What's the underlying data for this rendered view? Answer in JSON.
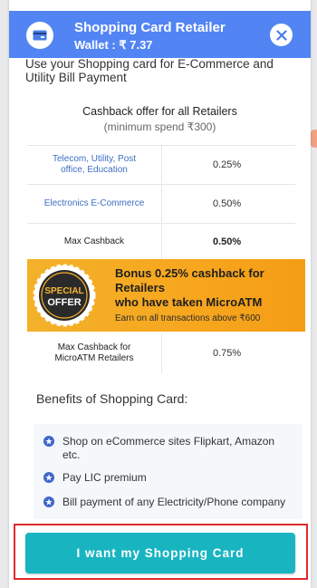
{
  "header": {
    "title": "Shopping Card Retailer",
    "wallet": "Wallet : ₹ 7.37",
    "icon": "card-icon",
    "close_icon": "close-icon",
    "color": "#5285f3"
  },
  "intro": {
    "line1": "Use your Shopping card for E-Commerce and",
    "line2": "Utility Bill Payment"
  },
  "offer": {
    "title": "Cashback offer for all Retailers",
    "subtitle": "(minimum spend ₹300)"
  },
  "table": {
    "rows": [
      {
        "label_line1": "Telecom, Utility, Post",
        "label_line2": "office, Education",
        "value": "0.25%"
      },
      {
        "label_line1": "Electronics E-Commerce",
        "label_line2": "",
        "value": "0.50%"
      },
      {
        "label_line1": "Max Cashback",
        "label_line2": "",
        "value": "0.50%"
      }
    ]
  },
  "banner": {
    "badge_line1": "SPECIAL",
    "badge_line2": "OFFER",
    "line1": "Bonus 0.25% cashback for",
    "line2": "Retailers",
    "line3": "who have taken MicroATM",
    "line4": "Earn on all transactions above ₹600"
  },
  "microatm": {
    "label_line1": "Max Cashback for",
    "label_line2": "MicroATM Retailers",
    "value": "0.75%"
  },
  "benefits": {
    "title": "Benefits of Shopping Card:",
    "items": [
      {
        "line1": "Shop on eCommerce sites Flipkart, Amazon",
        "line2": "etc."
      },
      {
        "line1": "Pay LIC premium",
        "line2": ""
      },
      {
        "line1": "Bill payment of any Electricity/Phone company",
        "line2": ""
      }
    ],
    "bullet_icon": "star-icon"
  },
  "cta": {
    "label": "I want my Shopping Card",
    "color": "#18b5c1"
  }
}
